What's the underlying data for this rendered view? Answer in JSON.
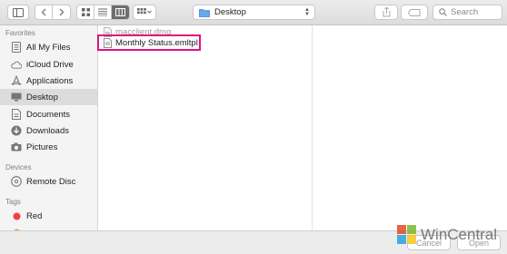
{
  "toolbar": {
    "location": "Desktop",
    "search_placeholder": "Search"
  },
  "sidebar": {
    "sections": {
      "favorites": "Favorites",
      "devices": "Devices",
      "tags": "Tags"
    },
    "favorites": [
      {
        "label": "All My Files",
        "icon": "all-files-icon"
      },
      {
        "label": "iCloud Drive",
        "icon": "cloud-icon"
      },
      {
        "label": "Applications",
        "icon": "applications-icon"
      },
      {
        "label": "Desktop",
        "icon": "desktop-icon",
        "selected": true
      },
      {
        "label": "Documents",
        "icon": "document-icon"
      },
      {
        "label": "Downloads",
        "icon": "download-icon"
      },
      {
        "label": "Pictures",
        "icon": "camera-icon"
      }
    ],
    "devices": [
      {
        "label": "Remote Disc",
        "icon": "disc-icon"
      }
    ],
    "tags": [
      {
        "label": "Red",
        "color": "#f2413b"
      }
    ]
  },
  "files": [
    {
      "name": "macclient.dmg",
      "dimmed": true
    },
    {
      "name": "Monthly Status.emltpl",
      "dimmed": false,
      "highlighted": true
    }
  ],
  "footer": {
    "cancel": "Cancel",
    "open": "Open"
  },
  "watermark": {
    "text": "WinCentral",
    "colors": [
      "#e14b2a",
      "#7cb82f",
      "#2aa3e0",
      "#f7c51e"
    ]
  },
  "colors": {
    "highlight": "#e2127d",
    "folder": "#4a90e2"
  }
}
